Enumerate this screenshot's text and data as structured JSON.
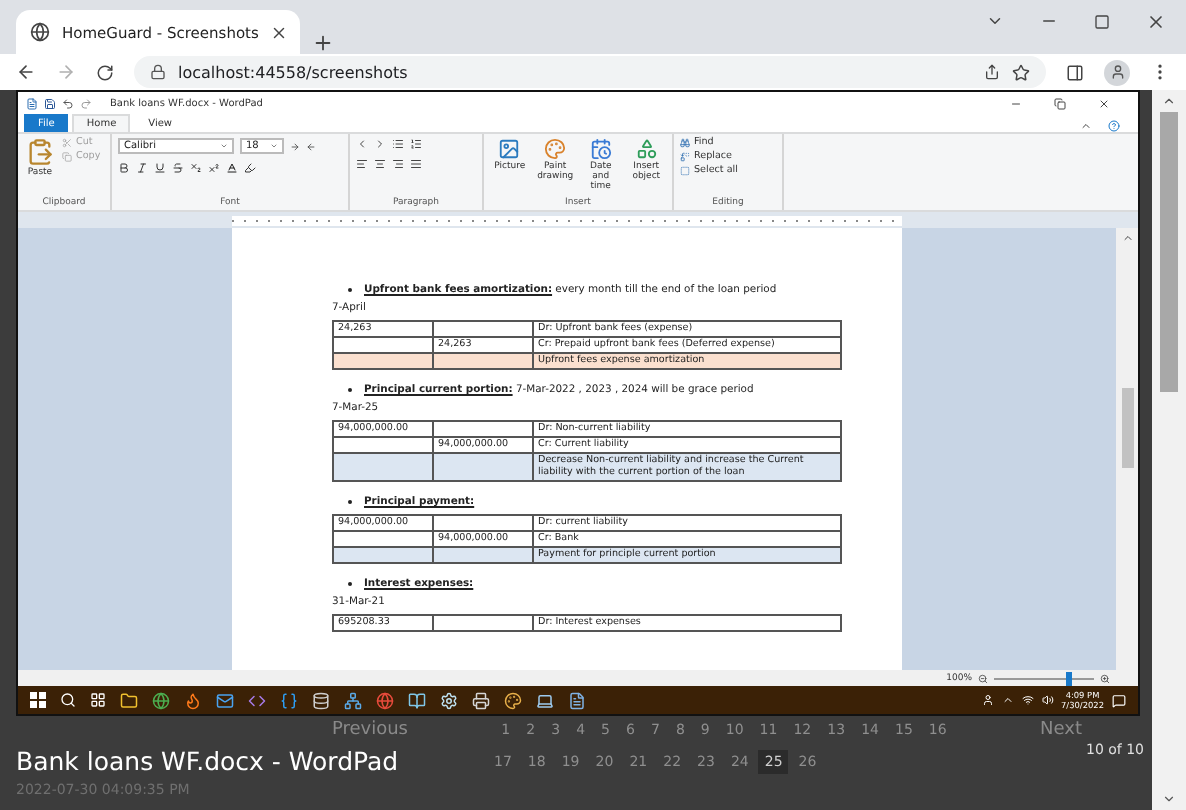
{
  "browser": {
    "tab_title": "HomeGuard - Screenshots",
    "url": "localhost:44558/screenshots"
  },
  "wordpad": {
    "title": "Bank loans WF.docx - WordPad",
    "ribbon_tabs": [
      {
        "label": "File",
        "kind": "file",
        "selected": false
      },
      {
        "label": "Home",
        "kind": "tab",
        "selected": true
      },
      {
        "label": "View",
        "kind": "tab",
        "selected": false
      }
    ],
    "clipboard": {
      "paste": "Paste",
      "cut": {
        "label": "Cut",
        "disabled": true
      },
      "copy": {
        "label": "Copy",
        "disabled": true
      },
      "group": "Clipboard"
    },
    "font": {
      "name": "Calibri",
      "size": "18",
      "group": "Font"
    },
    "paragraph": {
      "group": "Paragraph"
    },
    "insert": {
      "buttons": [
        "Picture",
        "Paint drawing",
        "Date and time",
        "Insert object"
      ],
      "group": "Insert"
    },
    "editing": {
      "items": [
        "Find",
        "Replace",
        "Select all"
      ],
      "group": "Editing"
    },
    "document": [
      {
        "kind": "bullet",
        "text": "**Upfront bank fees amortization:** every month till the end of the loan period"
      },
      {
        "kind": "date",
        "text": "7-April"
      },
      {
        "kind": "table",
        "rows": [
          {
            "column_1": "24,263",
            "column_3": "Dr: Upfront bank fees (expense)"
          },
          {
            "column_2": "24,263",
            "column_3": "Cr: Prepaid upfront bank fees (Deferred expense)"
          },
          {
            "column_3": "Upfront fees expense amortization",
            "color": "#fbe0cf"
          }
        ]
      },
      {
        "kind": "bullet",
        "text": "**Principal current portion:** 7-Mar-2022 , 2023 , 2024 will be grace period"
      },
      {
        "kind": "date",
        "text": "7-Mar-25"
      },
      {
        "kind": "table",
        "rows": [
          {
            "column_1": "94,000,000.00",
            "column_3": "Dr: Non-current liability"
          },
          {
            "column_2": "94,000,000.00",
            "column_3": "Cr: Current liability"
          },
          {
            "column_3": "Decrease Non-current liability and increase the Current liability with the current portion of the loan",
            "color": "#dce6f2"
          }
        ]
      },
      {
        "kind": "bullet",
        "text": "**Principal payment:**"
      },
      {
        "kind": "table",
        "rows": [
          {
            "column_1": "94,000,000.00",
            "column_3": "Dr: current liability"
          },
          {
            "column_2": "94,000,000.00",
            "column_3": "Cr: Bank"
          },
          {
            "column_3": "Payment for principle current portion",
            "color": "#dce6f2"
          }
        ]
      },
      {
        "kind": "bullet",
        "text": "**Interest expenses:**"
      },
      {
        "kind": "date",
        "text": "31-Mar-21"
      },
      {
        "kind": "table",
        "rows": [
          {
            "column_1": "695208.33",
            "column_3": "Dr: Interest expenses"
          }
        ]
      }
    ],
    "zoom": {
      "reading": "100%",
      "level": 0.72
    }
  },
  "taskbar": {
    "time": "4:09 PM",
    "date": "7/30/2022"
  },
  "viewer": {
    "previous": "Previous",
    "next": "Next",
    "pages": [
      {
        "label": "1",
        "selected": false
      },
      {
        "label": "2",
        "selected": false
      },
      {
        "label": "3",
        "selected": false
      },
      {
        "label": "4",
        "selected": false
      },
      {
        "label": "5",
        "selected": false
      },
      {
        "label": "6",
        "selected": false
      },
      {
        "label": "7",
        "selected": false
      },
      {
        "label": "8",
        "selected": false
      },
      {
        "label": "9",
        "selected": false
      },
      {
        "label": "10",
        "selected": false
      },
      {
        "label": "11",
        "selected": false
      },
      {
        "label": "12",
        "selected": false
      },
      {
        "label": "13",
        "selected": false
      },
      {
        "label": "14",
        "selected": false
      },
      {
        "label": "15",
        "selected": false
      },
      {
        "label": "16",
        "selected": false
      },
      {
        "label": "17",
        "selected": false
      },
      {
        "label": "18",
        "selected": false
      },
      {
        "label": "19",
        "selected": false
      },
      {
        "label": "20",
        "selected": false
      },
      {
        "label": "21",
        "selected": false
      },
      {
        "label": "22",
        "selected": false
      },
      {
        "label": "23",
        "selected": false
      },
      {
        "label": "24",
        "selected": false
      },
      {
        "label": "25",
        "selected": true
      },
      {
        "label": "26",
        "selected": false
      }
    ],
    "counter": "10 of 10",
    "caption": "Bank loans WF.docx - WordPad",
    "timestamp": "2022-07-30 04:09:35 PM"
  }
}
